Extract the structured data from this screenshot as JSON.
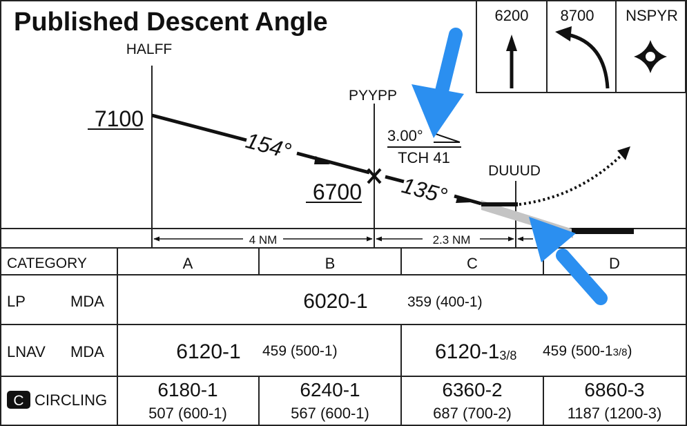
{
  "title": "Published Descent Angle",
  "colors": {
    "title": "#2b8ff0",
    "arrow": "#2b8ff0",
    "ink": "#111111",
    "glide_wedge": "#c4c4c4",
    "border": "#222222"
  },
  "missed_approach": {
    "boxes": [
      {
        "label": "6200",
        "icon": "arrow-up-icon"
      },
      {
        "label": "8700",
        "icon": "curved-arrow-left-icon"
      },
      {
        "label": "NSPYR",
        "icon": "holding-fix-star-icon"
      }
    ]
  },
  "profile": {
    "fixes": {
      "halff": "HALFF",
      "pyypp": "PYYPP",
      "duuud": "DUUUD"
    },
    "altitudes": {
      "halff": "7100",
      "pyypp": "6700"
    },
    "courses": {
      "first": "154°",
      "second": "135°"
    },
    "glidepath": {
      "angle": "3.00°",
      "tch": "TCH 41"
    },
    "distances": {
      "first": "4 NM",
      "second": "2.3 NM"
    }
  },
  "minimums": {
    "header_label": "CATEGORY",
    "categories": [
      "A",
      "B",
      "C",
      "D"
    ],
    "lp": {
      "label": "LP",
      "type": "MDA",
      "main": "6020-1",
      "sub": "359 (400-1)"
    },
    "lnav": {
      "label": "LNAV",
      "type": "MDA",
      "ab_main": "6120-1",
      "ab_sub": "459 (500-1)",
      "cd_main": "6120-1",
      "cd_frac": "3/8",
      "cd_sub": "459 (500-1",
      "cd_sub_frac": "3/8",
      "cd_sub_close": ")"
    },
    "circling": {
      "badge": "C",
      "label": "CIRCLING",
      "cells": [
        {
          "main": "6180-1",
          "sub": "507 (600-1)"
        },
        {
          "main": "6240-1",
          "sub": "567 (600-1)"
        },
        {
          "main": "6360-2",
          "sub": "687 (700-2)"
        },
        {
          "main": "6860-3",
          "sub": "1187 (1200-3)"
        }
      ]
    }
  }
}
